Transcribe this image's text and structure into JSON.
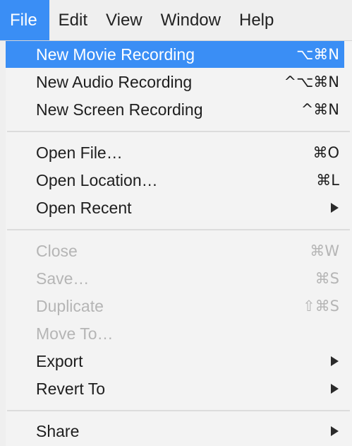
{
  "menubar": {
    "items": [
      {
        "label": "File",
        "active": true
      },
      {
        "label": "Edit"
      },
      {
        "label": "View"
      },
      {
        "label": "Window"
      },
      {
        "label": "Help"
      }
    ]
  },
  "file_menu": {
    "items": [
      {
        "label": "New Movie Recording",
        "shortcut": "⌥⌘N",
        "highlighted": true
      },
      {
        "label": "New Audio Recording",
        "shortcut": "^⌥⌘N"
      },
      {
        "label": "New Screen Recording",
        "shortcut": "^⌘N"
      },
      {
        "label": "Open File…",
        "shortcut": "⌘O"
      },
      {
        "label": "Open Location…",
        "shortcut": "⌘L"
      },
      {
        "label": "Open Recent",
        "submenu": true
      },
      {
        "label": "Close",
        "shortcut": "⌘W",
        "disabled": true
      },
      {
        "label": "Save…",
        "shortcut": "⌘S",
        "disabled": true
      },
      {
        "label": "Duplicate",
        "shortcut": "⇧⌘S",
        "disabled": true
      },
      {
        "label": "Move To…",
        "disabled": true
      },
      {
        "label": "Export",
        "submenu": true
      },
      {
        "label": "Revert To",
        "submenu": true
      },
      {
        "label": "Share",
        "submenu": true
      }
    ]
  },
  "colors": {
    "highlight": "#3a8ef5",
    "disabled_text": "#b5b5b5",
    "menu_background": "#f3f3f3"
  }
}
